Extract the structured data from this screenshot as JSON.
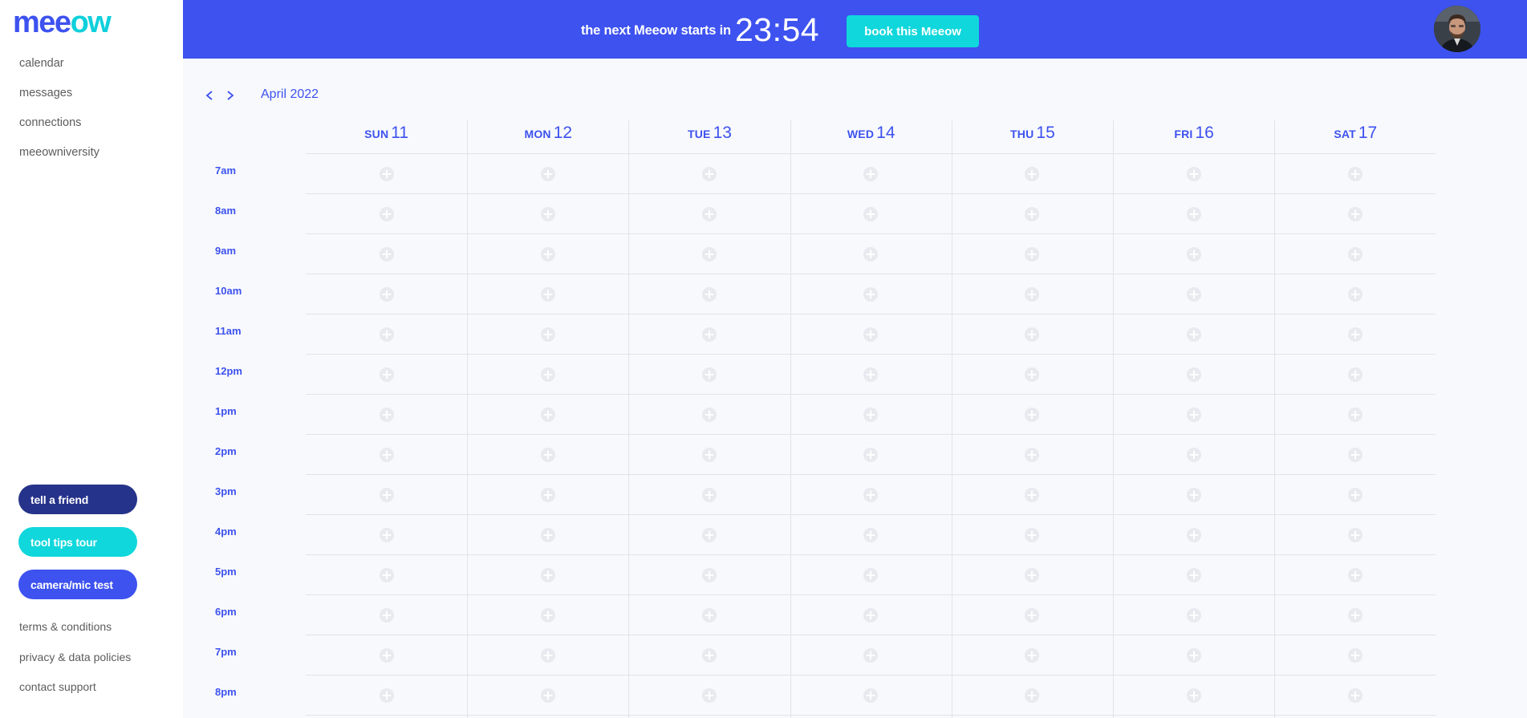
{
  "brand": {
    "logo_part1": "mee",
    "logo_part2": "ow"
  },
  "sidebar": {
    "nav": [
      "calendar",
      "messages",
      "connections",
      "meeowniversity"
    ],
    "buttons": [
      {
        "label": "tell a friend",
        "color": "#26338a"
      },
      {
        "label": "tool tips tour",
        "color": "#10d7dc"
      },
      {
        "label": "camera/mic test",
        "color": "#3d52ef"
      }
    ],
    "footer_links": [
      "terms & conditions",
      "privacy & data policies",
      "contact support"
    ]
  },
  "topbar": {
    "next_text": "the next Meeow starts in",
    "countdown": "23:54",
    "book_label": "book this Meeow",
    "bg_color": "#3d52ef",
    "accent_color": "#10d7dc"
  },
  "calendar": {
    "month_label": "April 2022",
    "days": [
      {
        "dow": "SUN",
        "num": "11"
      },
      {
        "dow": "MON",
        "num": "12"
      },
      {
        "dow": "TUE",
        "num": "13"
      },
      {
        "dow": "WED",
        "num": "14"
      },
      {
        "dow": "THU",
        "num": "15"
      },
      {
        "dow": "FRI",
        "num": "16"
      },
      {
        "dow": "SAT",
        "num": "17"
      }
    ],
    "hours": [
      "7am",
      "8am",
      "9am",
      "10am",
      "11am",
      "12pm",
      "1pm",
      "2pm",
      "3pm",
      "4pm",
      "5pm",
      "6pm",
      "7pm",
      "8pm"
    ],
    "icons": {
      "prev": "chevron-left-icon",
      "next": "chevron-right-icon",
      "slot": "add-circle-icon"
    }
  }
}
